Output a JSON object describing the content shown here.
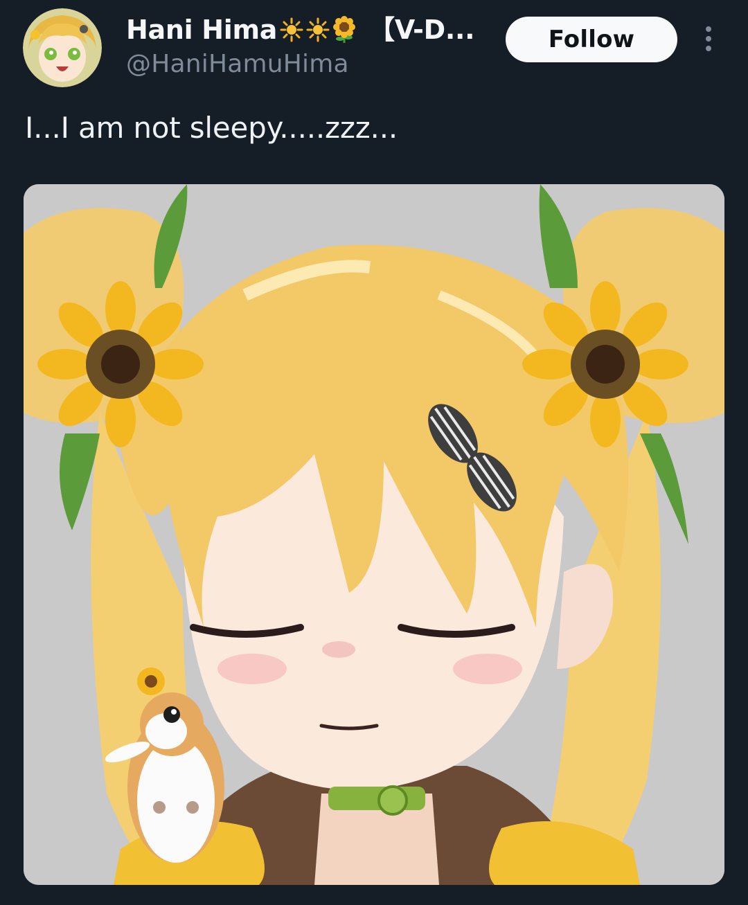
{
  "tweet": {
    "author": {
      "display_name": "Hani Hima",
      "display_name_suffix": "【V-D...",
      "name_emojis": [
        "sun-icon",
        "sun-icon",
        "sunflower-icon"
      ],
      "handle": "@HaniHamuHima",
      "avatar_icon": "avatar-image"
    },
    "follow_label": "Follow",
    "more_icon": "more-options-icon",
    "text": "I...I am not sleepy.....zzz...",
    "media": {
      "kind": "illustration",
      "subject_icon": "anime-girl-sleepy-illustration"
    }
  },
  "colors": {
    "background": "#151d27",
    "text_primary": "#eff2f5",
    "text_secondary": "#7f8b98",
    "follow_bg": "#f8f9fa",
    "follow_text": "#0f1419",
    "media_bg": "#c9c9c9"
  }
}
